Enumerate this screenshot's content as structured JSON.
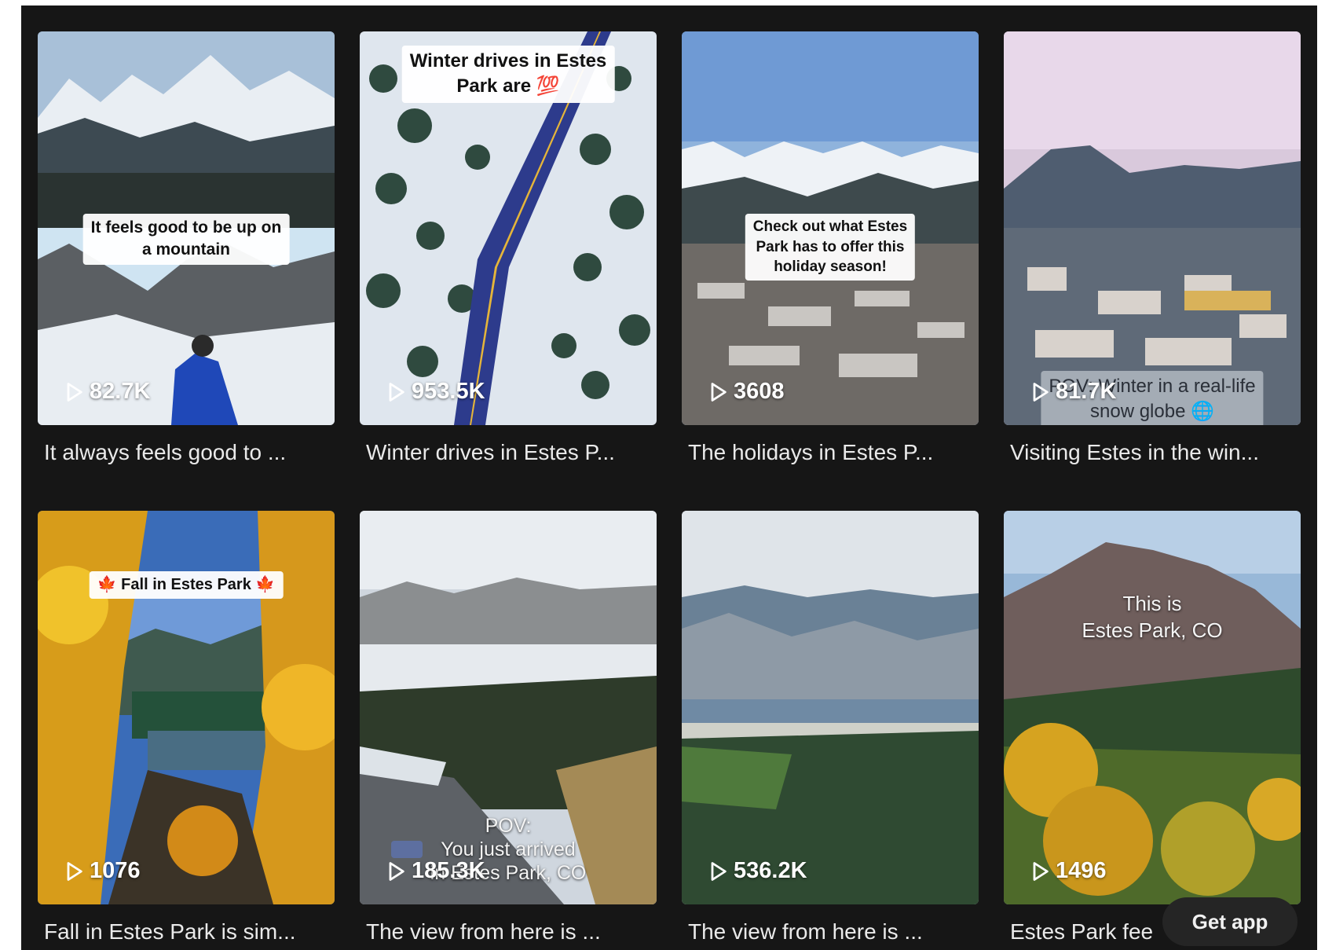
{
  "videos": [
    {
      "overlay": "It feels good to be up on\na mountain",
      "views": "82.7K",
      "caption": "It always feels good to ..."
    },
    {
      "overlay": "Winter drives in Estes\nPark are 💯",
      "views": "953.5K",
      "caption": "Winter drives in Estes P..."
    },
    {
      "overlay": "Check out what Estes\nPark has to offer this\nholiday season!",
      "views": "3608",
      "caption": "The holidays in Estes P..."
    },
    {
      "overlay": "POV: Winter in a real-life\nsnow globe 🌐",
      "views": "81.7K",
      "caption": "Visiting Estes in the win..."
    },
    {
      "overlay": "🍁 Fall in Estes Park 🍁",
      "views": "1076",
      "caption": "Fall in Estes Park is sim..."
    },
    {
      "overlay": "POV:\nYou just arrived\nin Estes Park, CO",
      "views": "185.3K",
      "caption": "The view from here is ..."
    },
    {
      "overlay": "",
      "views": "536.2K",
      "caption": "The view from here is ..."
    },
    {
      "overlay": "This is\nEstes Park, CO",
      "views": "1496",
      "caption": "Estes Park fee"
    }
  ],
  "get_app": "Get app",
  "icons": {
    "views": "play-outline-icon"
  }
}
